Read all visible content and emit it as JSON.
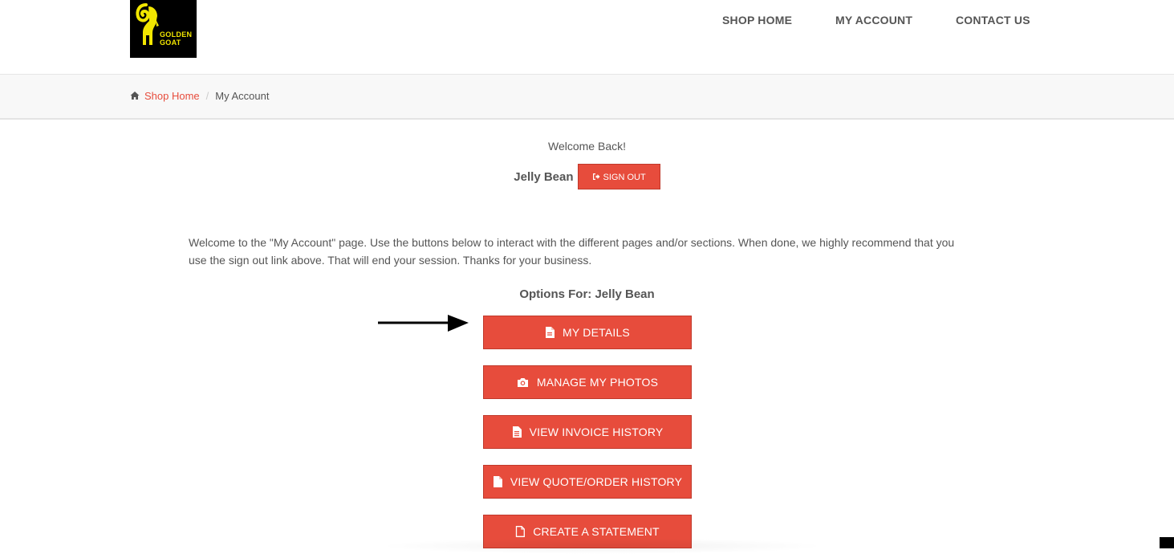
{
  "brand": {
    "logo_line1": "GOLDEN",
    "logo_line2": "GOAT",
    "logo_color": "#f2e600"
  },
  "nav": [
    {
      "label": "SHOP HOME"
    },
    {
      "label": "MY ACCOUNT"
    },
    {
      "label": "CONTACT US"
    }
  ],
  "breadcrumb": {
    "home_label": "Shop Home",
    "separator": "/",
    "current": "My Account"
  },
  "account": {
    "welcome": "Welcome Back!",
    "user_name": "Jelly Bean",
    "signout_label": "SIGN OUT",
    "intro": "Welcome to the \"My Account\" page. Use the buttons below to interact with the different pages and/or sections. When done, we highly recommend that you use the sign out link above. That will end your session. Thanks for your business.",
    "options_title": "Options For: Jelly Bean"
  },
  "options": [
    {
      "label": "MY DETAILS",
      "icon": "file-icon"
    },
    {
      "label": "MANAGE MY PHOTOS",
      "icon": "camera-icon"
    },
    {
      "label": "VIEW INVOICE HISTORY",
      "icon": "file-text-icon"
    },
    {
      "label": "VIEW QUOTE/ORDER HISTORY",
      "icon": "file-icon"
    },
    {
      "label": "CREATE A STATEMENT",
      "icon": "file-outline-icon"
    }
  ],
  "colors": {
    "accent": "#e74c3c",
    "text": "#555555"
  }
}
